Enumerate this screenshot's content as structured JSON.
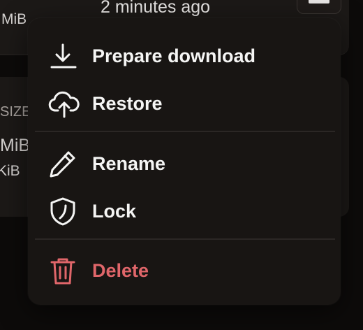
{
  "background": {
    "top_row": {
      "size_text": "MiB",
      "modified_text": "2 minutes ago"
    },
    "table": {
      "size_header": "SIZE",
      "row1_size": "MiB",
      "row2_size": "KiB"
    }
  },
  "menu": {
    "items": [
      {
        "label": "Prepare download",
        "icon": "download-icon"
      },
      {
        "label": "Restore",
        "icon": "cloud-upload-icon"
      },
      {
        "label": "Rename",
        "icon": "pencil-icon"
      },
      {
        "label": "Lock",
        "icon": "shield-icon"
      },
      {
        "label": "Delete",
        "icon": "trash-icon"
      }
    ]
  },
  "colors": {
    "danger": "#e0666a",
    "menu_bg": "#181513",
    "text": "#f5f5f4"
  }
}
